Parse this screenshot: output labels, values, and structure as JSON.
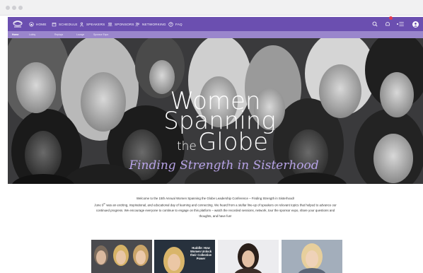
{
  "nav": {
    "items": [
      {
        "label": "HOME",
        "icon": "home-icon"
      },
      {
        "label": "SCHEDULE",
        "icon": "calendar-icon"
      },
      {
        "label": "SPEAKERS",
        "icon": "person-icon"
      },
      {
        "label": "SPONSORS",
        "icon": "people-icon"
      },
      {
        "label": "NETWORKING",
        "icon": "network-icon"
      },
      {
        "label": "FAQ",
        "icon": "question-icon"
      }
    ],
    "right_icons": [
      "search-icon",
      "notification-icon",
      "menu-icon",
      "user-avatar"
    ]
  },
  "subnav": {
    "items": [
      {
        "label": "Home"
      },
      {
        "label": "Lobby"
      },
      {
        "label": "Replays"
      },
      {
        "label": "Lounge"
      },
      {
        "label": "Sponsor Expo"
      }
    ]
  },
  "hero": {
    "line1": "Women",
    "line2": "Spanning",
    "line3a": "the",
    "line3b": "Globe",
    "tagline": "Finding Strength in Sisterhood"
  },
  "welcome": {
    "line1": "Welcome to the 15th Annual Women Spanning the Globe Leadership Conference – Finding Strength in Sisterhood!",
    "p1_start": "June 9",
    "p1_sup": "th",
    "p1_rest": " was an exciting, inspirational, and educational day of learning and connecting.  We heard from a stellar line-up of speakers on relevant topics that helped to advance our continued progress.  We encourage everyone to continue to engage on this platform – watch the recorded sessions, network, tour the sponsor expo, share your questions and thoughts, and have fun!"
  },
  "thumbnails": [
    {
      "caption": ""
    },
    {
      "caption": "Huddle: How Women Unlock their Collective Power"
    },
    {
      "caption": ""
    },
    {
      "caption": ""
    }
  ],
  "colors": {
    "nav_bg": "#6b4fb0",
    "subnav_bg": "#9a86cc",
    "hero_bg": "#2c2c2e",
    "tagline": "#b7a3e6",
    "notification": "#e23a4e"
  }
}
